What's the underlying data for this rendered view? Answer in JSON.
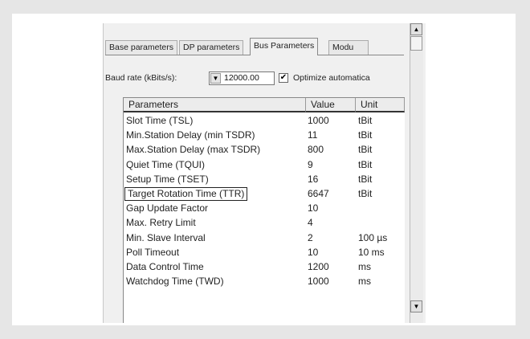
{
  "tabs": [
    "Base parameters",
    "DP parameters",
    "Bus Parameters",
    "Modu"
  ],
  "active_tab": "Bus Parameters",
  "baud": {
    "label": "Baud rate (kBits/s):",
    "value": "12000.00",
    "dropdown_icon": "chevron-down-icon"
  },
  "optimize": {
    "label": "Optimize automatica",
    "checked": true,
    "check_glyph": "✔"
  },
  "table": {
    "headers": [
      "Parameters",
      "Value",
      "Unit"
    ],
    "rows": [
      [
        "Slot Time (TSL)",
        "1000",
        "tBit"
      ],
      [
        "Min.Station Delay (min TSDR)",
        "11",
        "tBit"
      ],
      [
        "Max.Station Delay (max TSDR)",
        "800",
        "tBit"
      ],
      [
        "Quiet Time (TQUI)",
        "9",
        "tBit"
      ],
      [
        "Setup Time (TSET)",
        "16",
        "tBit"
      ],
      [
        "Target Rotation Time (TTR)",
        "6647",
        "tBit"
      ],
      [
        "Gap Update Factor",
        "10",
        ""
      ],
      [
        "Max. Retry Limit",
        "4",
        ""
      ],
      [
        "Min. Slave Interval",
        "2",
        "100 µs"
      ],
      [
        "Poll Timeout",
        "10",
        "10 ms"
      ],
      [
        "Data Control Time",
        "1200",
        "ms"
      ],
      [
        "Watchdog Time (TWD)",
        "1000",
        "ms"
      ]
    ],
    "focused_row_index": 5
  },
  "scroll_up_glyph": "▲",
  "scroll_down_glyph": "▼"
}
